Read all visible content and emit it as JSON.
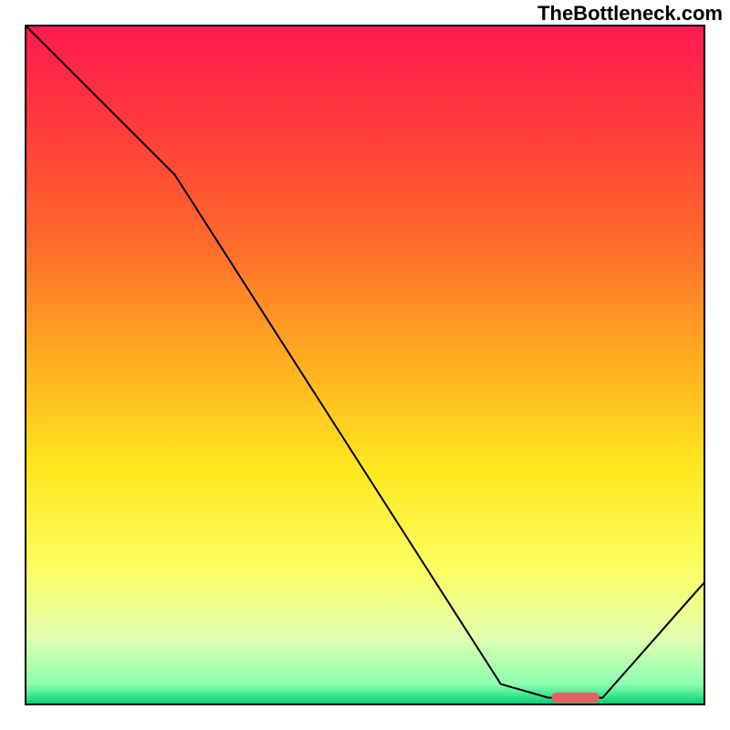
{
  "watermark": "TheBottleneck.com",
  "chart_data": {
    "type": "line",
    "title": "",
    "xlabel": "",
    "ylabel": "",
    "xlim": [
      0,
      100
    ],
    "ylim": [
      0,
      100
    ],
    "series": [
      {
        "name": "bottleneck-curve",
        "x": [
          0,
          22,
          70,
          77,
          85,
          100
        ],
        "y": [
          100,
          78,
          3,
          1,
          1,
          18
        ],
        "stroke": "#000000",
        "stroke_width": 2
      }
    ],
    "marker": {
      "name": "optimal-zone",
      "x_center": 81,
      "width_pct": 7,
      "color": "#e86060"
    },
    "gradient": {
      "direction": "vertical",
      "stops": [
        {
          "offset": 0.0,
          "color": "#ff1a50"
        },
        {
          "offset": 0.15,
          "color": "#ff3b3b"
        },
        {
          "offset": 0.32,
          "color": "#ff6a2b"
        },
        {
          "offset": 0.5,
          "color": "#ffb020"
        },
        {
          "offset": 0.65,
          "color": "#ffe61e"
        },
        {
          "offset": 0.8,
          "color": "#fbff60"
        },
        {
          "offset": 0.9,
          "color": "#e3ffb0"
        },
        {
          "offset": 0.97,
          "color": "#8dffb0"
        },
        {
          "offset": 1.0,
          "color": "#00d070"
        }
      ]
    },
    "frame_inset_pct": {
      "left": 3.5,
      "right": 3.5,
      "top": 3.5,
      "bottom": 3.5
    }
  }
}
